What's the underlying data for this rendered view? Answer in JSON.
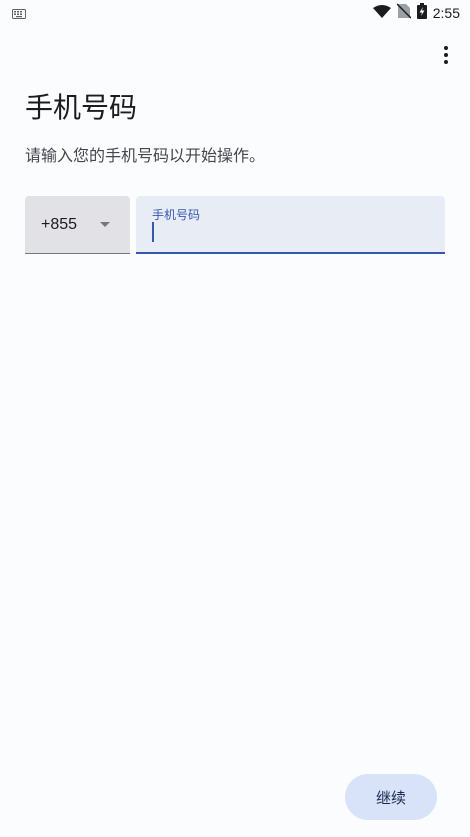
{
  "status_bar": {
    "time": "2:55",
    "icons": [
      "keyboard-icon",
      "wifi-icon",
      "no-sim-icon",
      "battery-charging-icon"
    ]
  },
  "toolbar": {
    "overflow_icon": "more-vert-icon"
  },
  "main": {
    "title": "手机号码",
    "subtitle": "请输入您的手机号码以开始操作。",
    "country_code": {
      "value": "+855",
      "icon": "dropdown-arrow-icon"
    },
    "phone_input": {
      "label": "手机号码",
      "value": ""
    },
    "continue_label": "继续"
  },
  "colors": {
    "background": "#fbfcfe",
    "accent": "#3457b0",
    "button_bg": "#d8e2f8",
    "input_bg": "#e8edf5",
    "select_bg": "#e2e2e6"
  }
}
